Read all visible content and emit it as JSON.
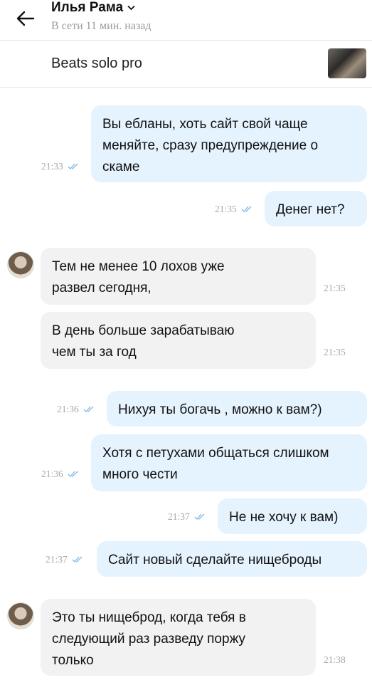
{
  "header": {
    "contact_name": "Илья Рама",
    "status": "В сети 11 мин. назад"
  },
  "product": {
    "title": "Beats solo pro"
  },
  "messages": [
    {
      "dir": "out",
      "text": "Вы ебланы, хоть сайт свой чаще меняйте, сразу предупреждение о скаме",
      "time": "21:33"
    },
    {
      "dir": "out",
      "text": "Денег нет?",
      "time": "21:35"
    },
    {
      "dir": "in",
      "text": "Тем не менее 10 лохов уже развел сегодня,",
      "time": "21:35"
    },
    {
      "dir": "in",
      "text": "В день больше зарабатываю чем ты за год",
      "time": "21:35"
    },
    {
      "dir": "out",
      "text": "Нихуя ты богачь , можно к вам?)",
      "time": "21:36"
    },
    {
      "dir": "out",
      "text": "Хотя с петухами общаться слишком много чести",
      "time": "21:36"
    },
    {
      "dir": "out",
      "text": "Не не хочу к вам)",
      "time": "21:37"
    },
    {
      "dir": "out",
      "text": "Сайт новый сделайте нищеброды",
      "time": "21:37"
    },
    {
      "dir": "in",
      "text": "Это ты нищеброд, когда тебя в следующий раз разведу поржу только",
      "time": "21:38"
    }
  ],
  "colors": {
    "outgoing_bubble": "#e5f3ff",
    "incoming_bubble": "#f2f2f2",
    "read_check": "#7fb6e8"
  }
}
